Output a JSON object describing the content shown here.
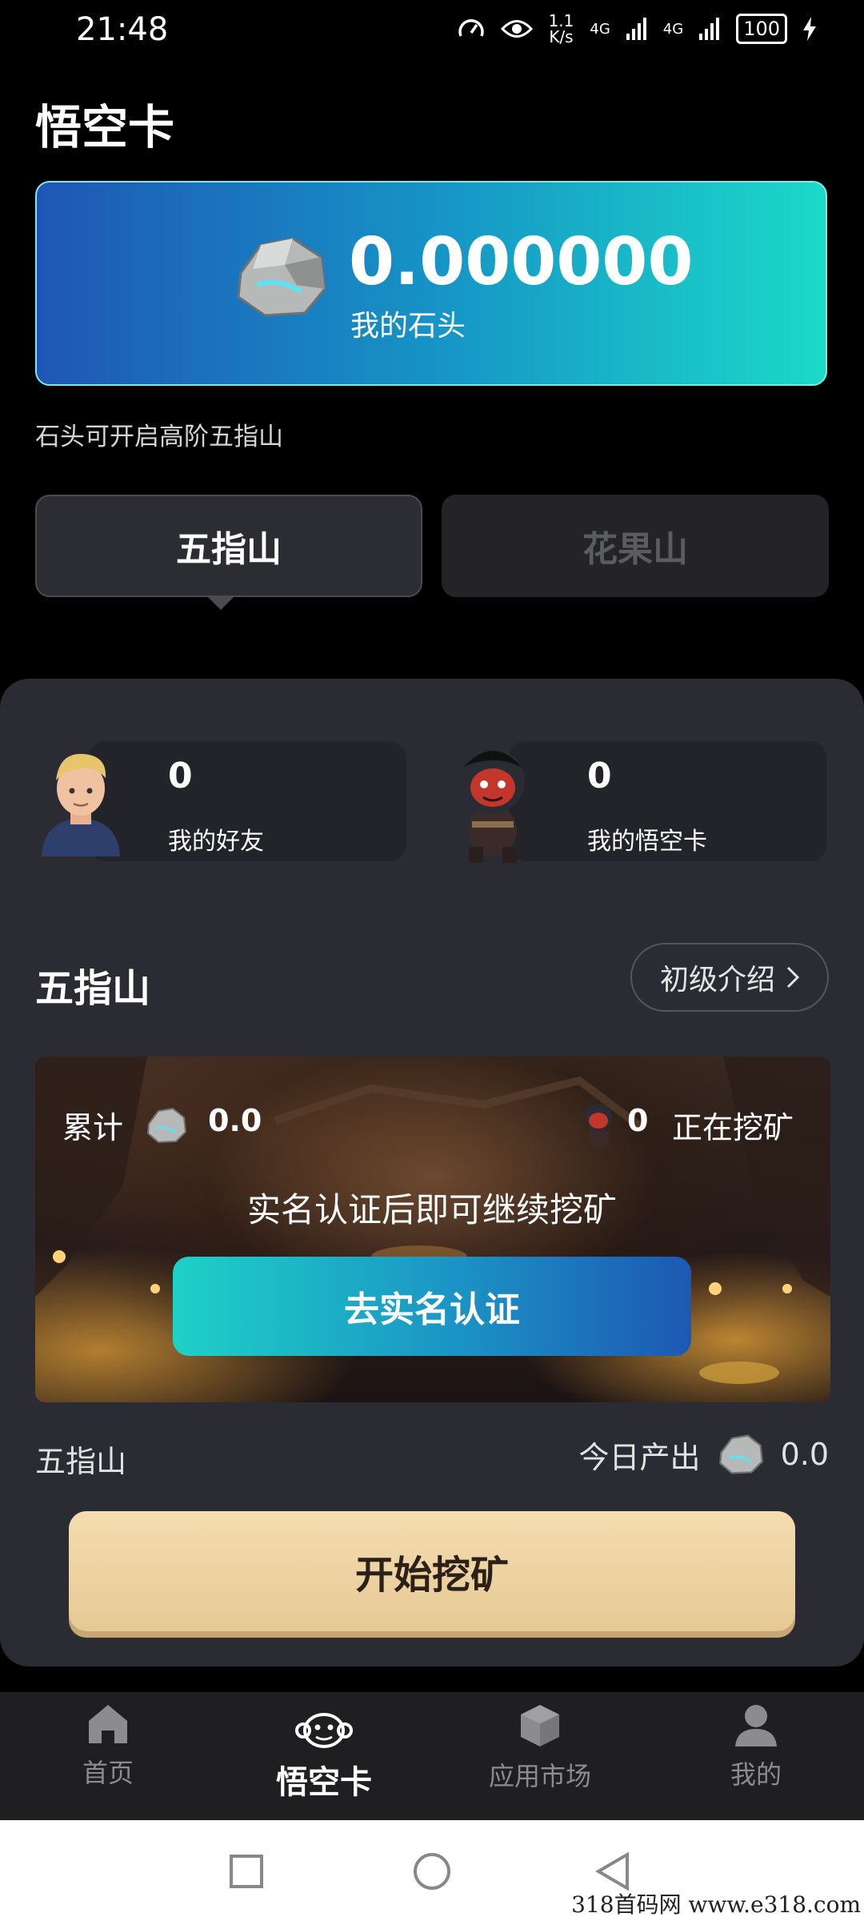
{
  "status_bar": {
    "time": "21:48",
    "net_speed_top": "1.1",
    "net_speed_bottom": "K/s",
    "signal1": "4G",
    "signal2": "4G",
    "battery": "100"
  },
  "page": {
    "title": "悟空卡"
  },
  "balance": {
    "value": "0.000000",
    "label": "我的石头"
  },
  "hint": "石头可开启高阶五指山",
  "tabs": [
    {
      "label": "五指山",
      "active": true
    },
    {
      "label": "花果山",
      "active": false
    }
  ],
  "stats": {
    "friends": {
      "value": "0",
      "label": "我的好友"
    },
    "cards": {
      "value": "0",
      "label": "我的悟空卡"
    }
  },
  "section": {
    "title": "五指山",
    "intro_button": "初级介绍"
  },
  "mine": {
    "total_label": "累计",
    "total_value": "0.0",
    "mining_count": "0",
    "mining_label": "正在挖矿",
    "message": "实名认证后即可继续挖矿",
    "verify_button": "去实名认证"
  },
  "footer": {
    "left_label": "五指山",
    "today_label": "今日产出",
    "today_value": "0.0"
  },
  "start_button": "开始挖矿",
  "nav": [
    {
      "label": "首页",
      "icon": "home-icon"
    },
    {
      "label": "悟空卡",
      "icon": "monkey-icon"
    },
    {
      "label": "应用市场",
      "icon": "cube-icon"
    },
    {
      "label": "我的",
      "icon": "user-icon"
    }
  ],
  "watermark": "318首码网  www.e318.com"
}
